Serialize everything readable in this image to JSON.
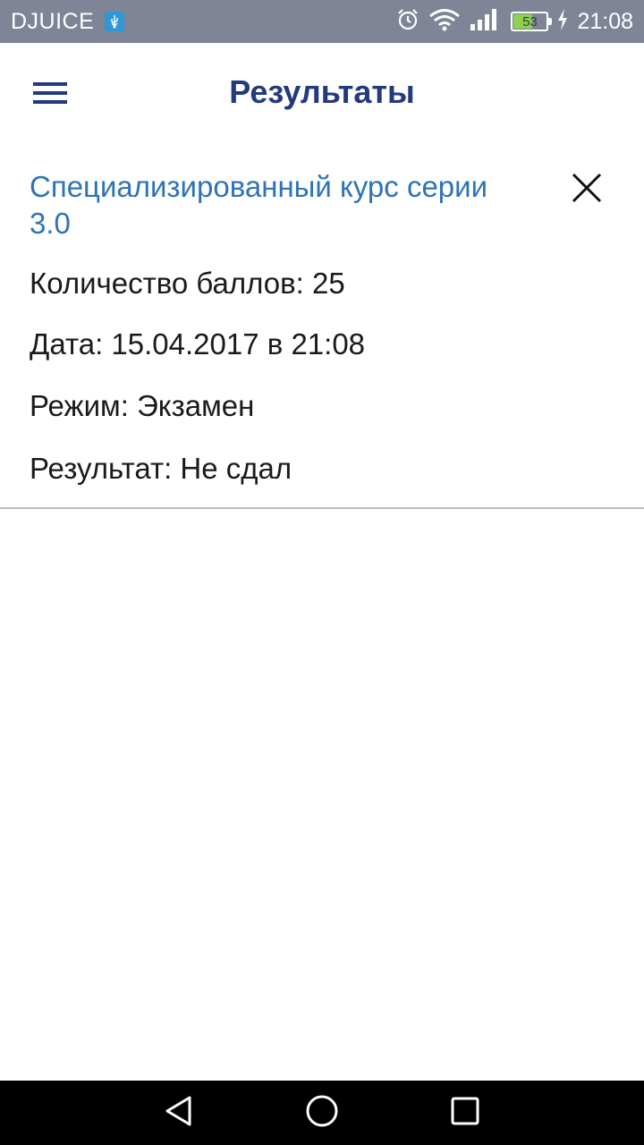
{
  "status_bar": {
    "carrier": "DJUICE",
    "battery_level": "53",
    "time": "21:08",
    "icons": [
      "usb-icon",
      "alarm-icon",
      "wifi-icon",
      "signal-icon",
      "battery-icon",
      "charging-icon"
    ],
    "background": "#7f8596"
  },
  "app_bar": {
    "title": "Результаты",
    "menu_icon": "hamburger-menu-icon",
    "title_color": "#233a7c"
  },
  "result": {
    "course_title": "Специализированный курс серии 3.0",
    "score_line": "Количество баллов: 25",
    "date_line": "Дата: 15.04.2017 в 21:08",
    "mode_line": "Режим: Экзамен",
    "result_line": "Результат: Не сдал",
    "close_icon": "close-icon",
    "title_color": "#2e73b8"
  },
  "nav_bar": {
    "icons": [
      "back-icon",
      "home-icon",
      "recent-apps-icon"
    ]
  }
}
